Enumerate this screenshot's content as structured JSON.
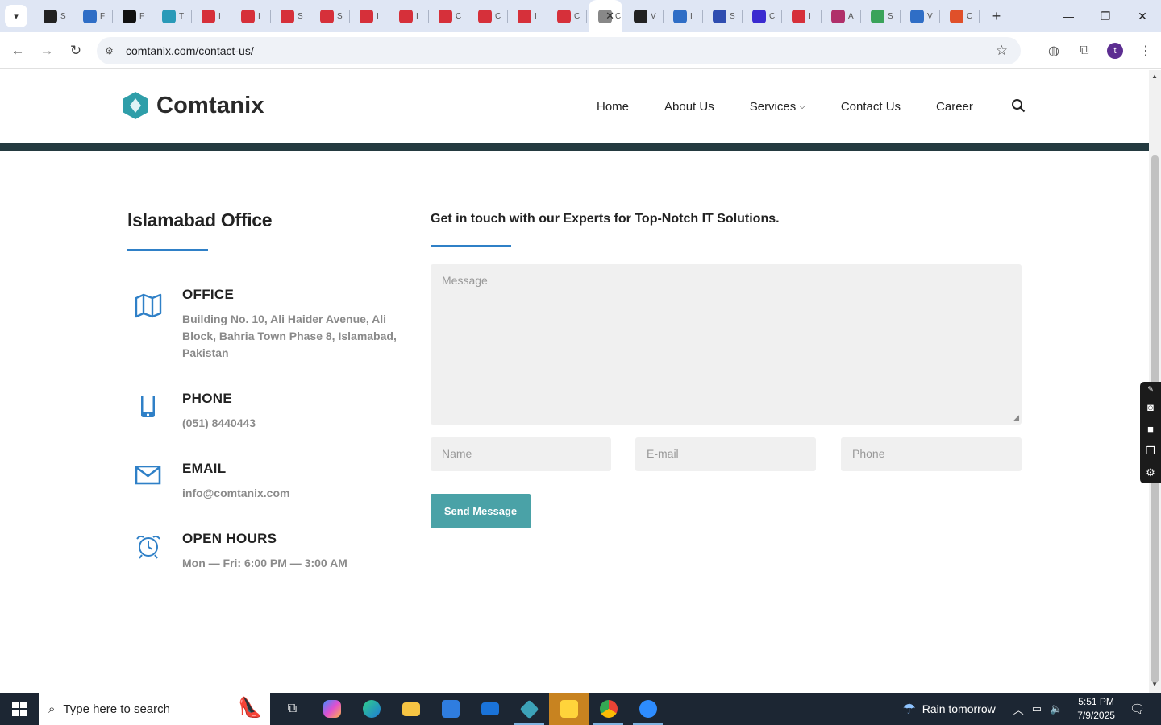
{
  "browser": {
    "tabs": [
      {
        "letter": "S",
        "color": "#222222"
      },
      {
        "letter": "F",
        "color": "#2f6ec6"
      },
      {
        "letter": "F",
        "color": "#111111"
      },
      {
        "letter": "T",
        "color": "#2a9ab8"
      },
      {
        "letter": "I",
        "color": "#d6303a"
      },
      {
        "letter": "I",
        "color": "#d6303a"
      },
      {
        "letter": "S",
        "color": "#d6303a"
      },
      {
        "letter": "S",
        "color": "#d6303a"
      },
      {
        "letter": "I",
        "color": "#d6303a"
      },
      {
        "letter": "I",
        "color": "#d6303a"
      },
      {
        "letter": "C",
        "color": "#d6303a"
      },
      {
        "letter": "C",
        "color": "#d6303a"
      },
      {
        "letter": "I",
        "color": "#d6303a"
      },
      {
        "letter": "C",
        "color": "#d6303a"
      },
      {
        "letter": "C",
        "color": "#888888",
        "active": true
      },
      {
        "letter": "V",
        "color": "#222222"
      },
      {
        "letter": "I",
        "color": "#2f6ec6"
      },
      {
        "letter": "S",
        "color": "#2f4db0"
      },
      {
        "letter": "C",
        "color": "#3a2ad0"
      },
      {
        "letter": "I",
        "color": "#d6303a"
      },
      {
        "letter": "A",
        "color": "#b0306a"
      },
      {
        "letter": "S",
        "color": "#3aa35a"
      },
      {
        "letter": "V",
        "color": "#2f6ec6"
      },
      {
        "letter": "C",
        "color": "#e0502a"
      }
    ],
    "url": "comtanix.com/contact-us/",
    "profile_initial": "t"
  },
  "site": {
    "brand": "Comtanix",
    "nav": {
      "home": "Home",
      "about": "About Us",
      "services": "Services",
      "contact": "Contact Us",
      "career": "Career"
    },
    "office_title": "Islamabad Office",
    "office": {
      "label": "OFFICE",
      "value": "Building No. 10, Ali Haider Avenue, Ali Block, Bahria Town Phase 8, Islamabad, Pakistan"
    },
    "phone": {
      "label": "PHONE",
      "value": "(051) 8440443"
    },
    "email": {
      "label": "EMAIL",
      "value": "info@comtanix.com"
    },
    "hours": {
      "label": "OPEN HOURS",
      "value": "Mon — Fri: 6:00 PM — 3:00 AM"
    },
    "form": {
      "title": "Get in touch with our Experts for Top-Notch IT Solutions.",
      "message_placeholder": "Message",
      "name_placeholder": "Name",
      "email_placeholder": "E-mail",
      "phone_placeholder": "Phone",
      "submit_label": "Send Message"
    },
    "colors": {
      "accent": "#2f80c7",
      "button": "#4aa2a7",
      "band": "#243a40"
    }
  },
  "taskbar": {
    "search_placeholder": "Type here to search",
    "weather": "Rain tomorrow",
    "time": "5:51 PM",
    "date": "7/9/2025"
  }
}
